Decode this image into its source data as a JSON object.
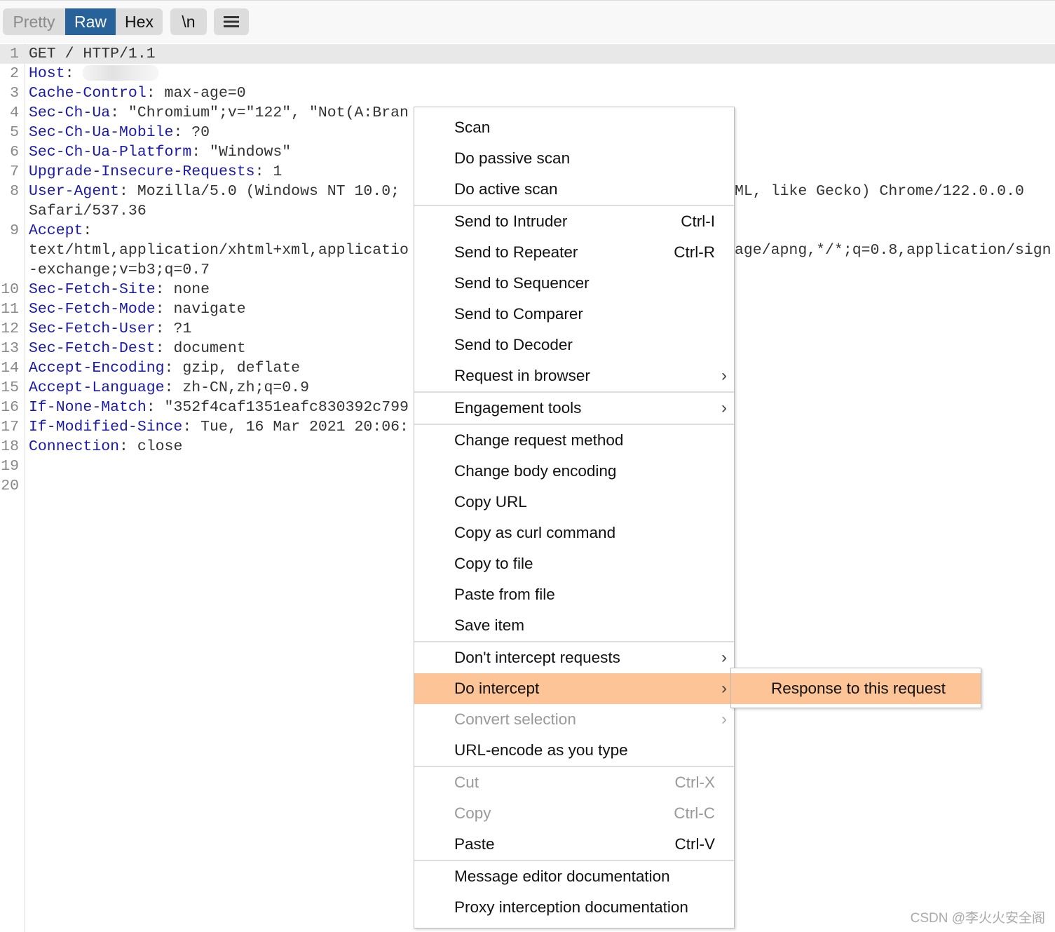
{
  "toolbar": {
    "view_tabs": [
      {
        "label": "Pretty",
        "state": "inactive"
      },
      {
        "label": "Raw",
        "state": "active"
      },
      {
        "label": "Hex",
        "state": "normal"
      }
    ],
    "newline_toggle": "\\n",
    "menu_icon": "hamburger-icon",
    "active_color": "#27629a"
  },
  "editor": {
    "lines": [
      {
        "n": "1",
        "key": "",
        "value": "GET / HTTP/1.1"
      },
      {
        "n": "2",
        "key": "Host",
        "value": ": ",
        "redacted": true
      },
      {
        "n": "3",
        "key": "Cache-Control",
        "value": ": max-age=0"
      },
      {
        "n": "4",
        "key": "Sec-Ch-Ua",
        "value": ": \"Chromium\";v=\"122\", \"Not(A:Bran"
      },
      {
        "n": "5",
        "key": "Sec-Ch-Ua-Mobile",
        "value": ": ?0"
      },
      {
        "n": "6",
        "key": "Sec-Ch-Ua-Platform",
        "value": ": \"Windows\""
      },
      {
        "n": "7",
        "key": "Upgrade-Insecure-Requests",
        "value": ": 1"
      },
      {
        "n": "8",
        "key": "User-Agent",
        "value": ": Mozilla/5.0 (Windows NT 10.0;",
        "value_right": "ML, like Gecko) Chrome/122.0.0.0"
      },
      {
        "n": "",
        "key": "",
        "value": "Safari/537.36"
      },
      {
        "n": "9",
        "key": "Accept",
        "value": ":"
      },
      {
        "n": "",
        "key": "",
        "value": "text/html,application/xhtml+xml,applicatio",
        "value_right": "age/apng,*/*;q=0.8,application/sign"
      },
      {
        "n": "",
        "key": "",
        "value": "-exchange;v=b3;q=0.7"
      },
      {
        "n": "10",
        "key": "Sec-Fetch-Site",
        "value": ": none"
      },
      {
        "n": "11",
        "key": "Sec-Fetch-Mode",
        "value": ": navigate"
      },
      {
        "n": "12",
        "key": "Sec-Fetch-User",
        "value": ": ?1"
      },
      {
        "n": "13",
        "key": "Sec-Fetch-Dest",
        "value": ": document"
      },
      {
        "n": "14",
        "key": "Accept-Encoding",
        "value": ": gzip, deflate"
      },
      {
        "n": "15",
        "key": "Accept-Language",
        "value": ": zh-CN,zh;q=0.9"
      },
      {
        "n": "16",
        "key": "If-None-Match",
        "value": ": \"352f4caf1351eafc830392c799"
      },
      {
        "n": "17",
        "key": "If-Modified-Since",
        "value": ": Tue, 16 Mar 2021 20:06:"
      },
      {
        "n": "18",
        "key": "Connection",
        "value": ": close"
      },
      {
        "n": "19",
        "key": "",
        "value": ""
      },
      {
        "n": "20",
        "key": "",
        "value": ""
      }
    ]
  },
  "context_menu": {
    "highlight_color": "#fdc597",
    "groups": [
      [
        {
          "label": "Scan"
        },
        {
          "label": "Do passive scan"
        },
        {
          "label": "Do active scan"
        }
      ],
      [
        {
          "label": "Send to Intruder",
          "shortcut": "Ctrl-I"
        },
        {
          "label": "Send to Repeater",
          "shortcut": "Ctrl-R"
        },
        {
          "label": "Send to Sequencer"
        },
        {
          "label": "Send to Comparer"
        },
        {
          "label": "Send to Decoder"
        },
        {
          "label": "Request in browser",
          "submenu": true
        }
      ],
      [
        {
          "label": "Engagement tools",
          "submenu": true
        }
      ],
      [
        {
          "label": "Change request method"
        },
        {
          "label": "Change body encoding"
        },
        {
          "label": "Copy URL"
        },
        {
          "label": "Copy as curl command"
        },
        {
          "label": "Copy to file"
        },
        {
          "label": "Paste from file"
        },
        {
          "label": "Save item"
        }
      ],
      [
        {
          "label": "Don't intercept requests",
          "submenu": true
        },
        {
          "label": "Do intercept",
          "submenu": true,
          "highlighted": true
        },
        {
          "label": "Convert selection",
          "submenu": true,
          "disabled": true
        },
        {
          "label": "URL-encode as you type"
        }
      ],
      [
        {
          "label": "Cut",
          "shortcut": "Ctrl-X",
          "disabled": true
        },
        {
          "label": "Copy",
          "shortcut": "Ctrl-C",
          "disabled": true
        },
        {
          "label": "Paste",
          "shortcut": "Ctrl-V"
        }
      ],
      [
        {
          "label": "Message editor documentation"
        },
        {
          "label": "Proxy interception documentation"
        }
      ]
    ],
    "submenu_arrow": "›"
  },
  "submenu": {
    "items": [
      {
        "label": "Response to this request",
        "highlighted": true
      }
    ]
  },
  "watermark": "CSDN @李火火安全阁"
}
